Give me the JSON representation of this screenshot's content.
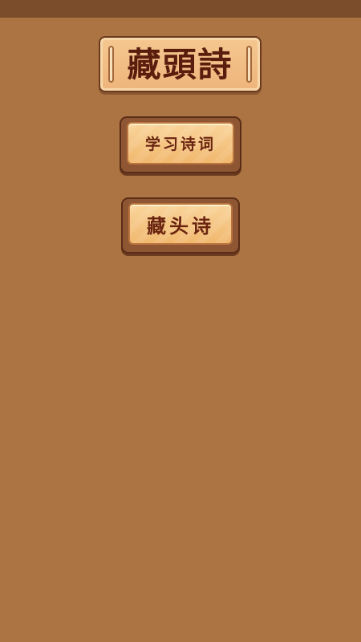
{
  "title": "藏頭詩",
  "menu": {
    "learn_label": "学习诗词",
    "acrostic_label": "藏头诗"
  },
  "colors": {
    "background": "#ad7443",
    "status_bar": "#7b4d2b",
    "text_dark": "#5a1d0d"
  }
}
